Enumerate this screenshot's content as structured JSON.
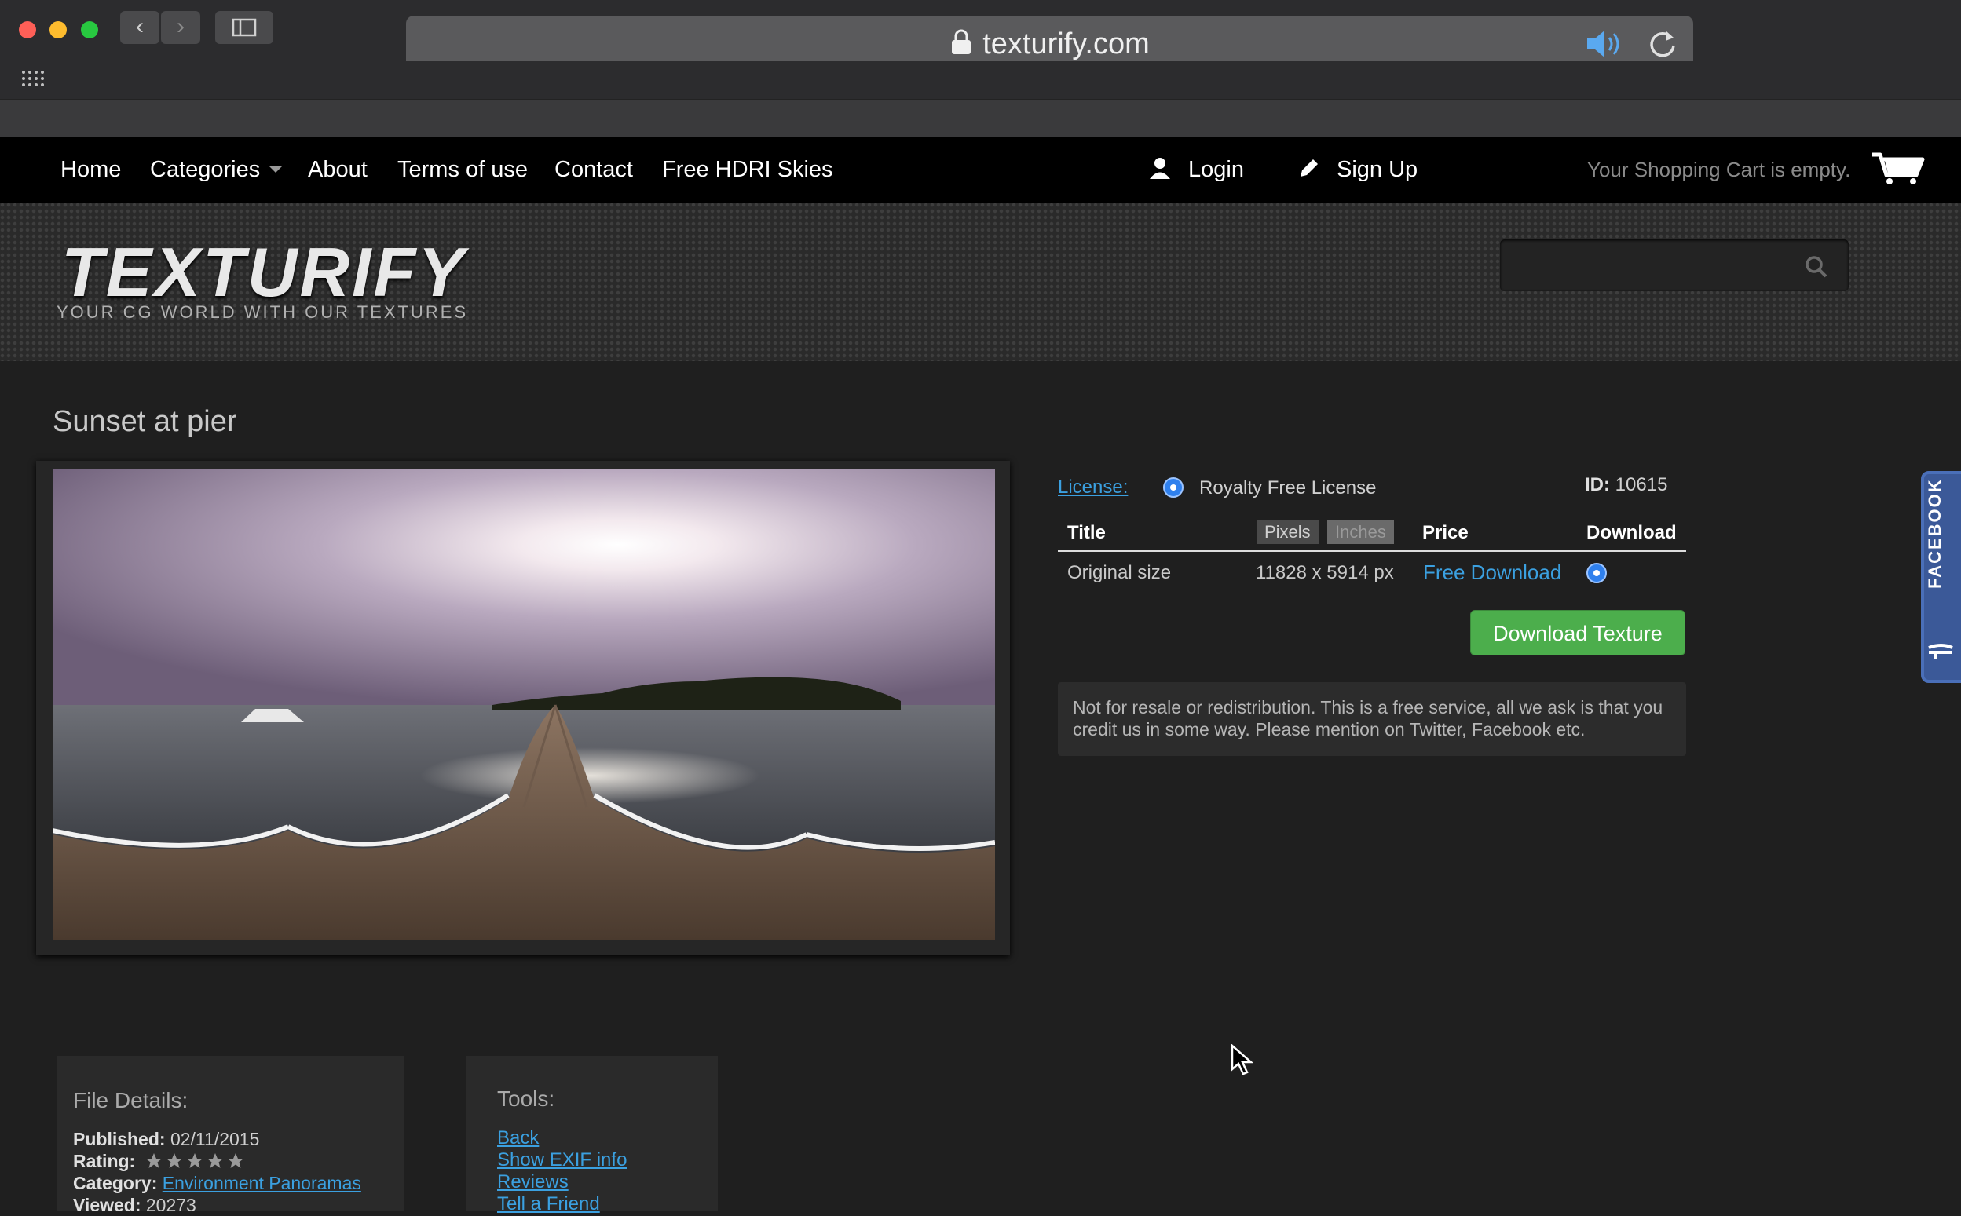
{
  "browser": {
    "url": "texturify.com",
    "back_glyph": "‹",
    "forward_glyph": "›"
  },
  "nav": {
    "items": [
      "Home",
      "Categories",
      "About",
      "Terms of use",
      "Contact",
      "Free HDRI Skies"
    ],
    "login": "Login",
    "signup": "Sign Up",
    "cart": "Your Shopping Cart is empty."
  },
  "header": {
    "logo": "TEXTURIFY",
    "tagline": "YOUR CG WORLD WITH OUR TEXTURES",
    "search_placeholder": ""
  },
  "product": {
    "title": "Sunset at pier",
    "license_label": "License:",
    "license_value": "Royalty Free License",
    "id_label": "ID:",
    "id_value": "10615",
    "table": {
      "headers": {
        "title": "Title",
        "pixels": "Pixels",
        "inches": "Inches",
        "price": "Price",
        "download": "Download"
      },
      "row": {
        "title": "Original size",
        "size": "11828 x 5914 px",
        "price": "Free Download"
      }
    },
    "download_button": "Download Texture",
    "notice": "Not for resale or redistribution. This is a free service, all we ask is that you credit us in some way. Please mention on Twitter, Facebook etc."
  },
  "side_tab": {
    "label": "FACEBOOK"
  },
  "file_details": {
    "heading": "File Details:",
    "published_label": "Published:",
    "published_value": "02/11/2015",
    "rating_label": "Rating:",
    "rating_stars": 5,
    "category_label": "Category:",
    "category_value": "Environment Panoramas",
    "viewed_label": "Viewed:",
    "viewed_value": "20273"
  },
  "tools": {
    "heading": "Tools:",
    "links": [
      "Back",
      "Show EXIF info",
      "Reviews",
      "Tell a Friend"
    ]
  },
  "colors": {
    "accent": "#3ba0e0",
    "download_green": "#4cae4c",
    "nav_bg": "#000000",
    "facebook": "#3b5998"
  }
}
